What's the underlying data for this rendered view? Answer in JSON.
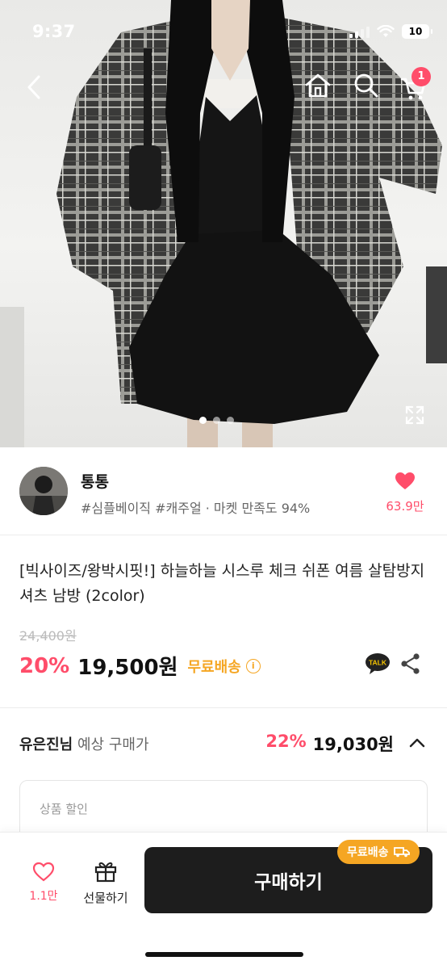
{
  "status": {
    "time": "9:37",
    "battery": "10"
  },
  "nav": {
    "cart_count": "1"
  },
  "gallery": {
    "total": 3,
    "current": 1
  },
  "seller": {
    "name": "통통",
    "tags": "#심플베이직 #캐주얼 · 마켓 만족도 94%",
    "likes": "63.9만"
  },
  "product": {
    "title": "[빅사이즈/왕박시핏!] 하늘하늘 시스루 체크 쉬폰 여름 살탐방지 셔츠 남방 (2color)",
    "original_price": "24,400원",
    "discount": "20%",
    "price": "19,500원",
    "shipping": "무료배송",
    "talk_label": "TALK"
  },
  "expected": {
    "user": "유은진님",
    "label": "예상 구매가",
    "discount": "22%",
    "price": "19,030원"
  },
  "discount_card": {
    "label": "상품 할인"
  },
  "bottom": {
    "likes": "1.1만",
    "gift_label": "선물하기",
    "buy_label": "구매하기",
    "shipping_badge": "무료배송"
  },
  "colors": {
    "accent": "#ff4d6a",
    "shipping": "#f5a623",
    "button": "#1d1d1d"
  }
}
